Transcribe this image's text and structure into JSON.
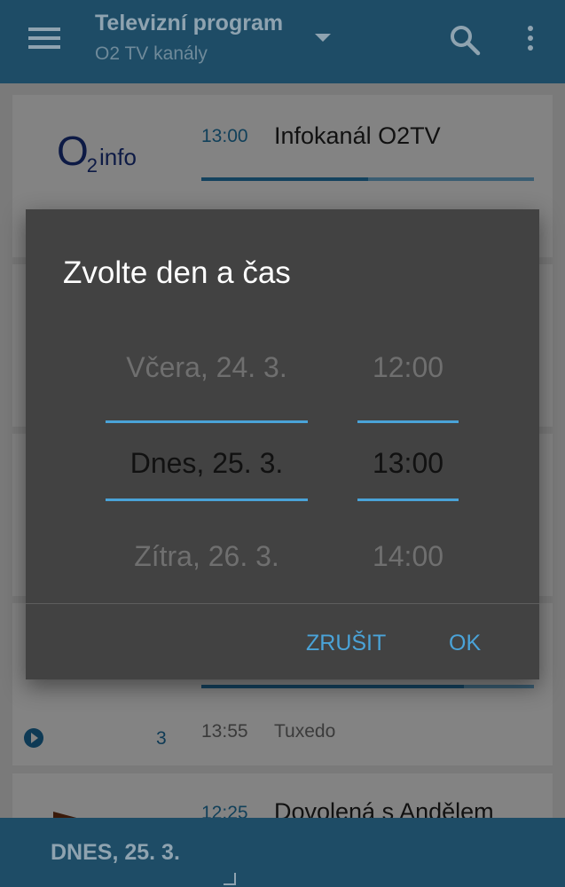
{
  "app_bar": {
    "title": "Televizní program",
    "subtitle": "O2 TV kanály",
    "menu_icon": "hamburger-menu-icon",
    "dropdown_icon": "dropdown-arrow-icon",
    "search_icon": "search-icon",
    "more_icon": "more-vert-icon",
    "color": "#2b6e94"
  },
  "programs": [
    {
      "channel_logo": {
        "big": "O",
        "sub": "2",
        "label": "info"
      },
      "time": "13:00",
      "title": "Infokanál O2TV",
      "progress": 0.5
    },
    {
      "channel_number": "3",
      "time": "13:55",
      "title": "Tuxedo",
      "prev_progress": 0.79
    },
    {
      "time": "12:25",
      "title": "Dovolená s Andělem"
    }
  ],
  "dialog": {
    "title": "Zvolte den a čas",
    "days": {
      "previous": "Včera, 24. 3.",
      "selected": "Dnes, 25. 3.",
      "next": "Zítra, 26. 3."
    },
    "times": {
      "previous": "12:00",
      "selected": "13:00",
      "next": "14:00"
    },
    "cancel_label": "ZRUŠIT",
    "ok_label": "OK",
    "accent_color": "#4aa3d8"
  },
  "bottom_bar": {
    "date_label": "DNES, 25. 3."
  }
}
